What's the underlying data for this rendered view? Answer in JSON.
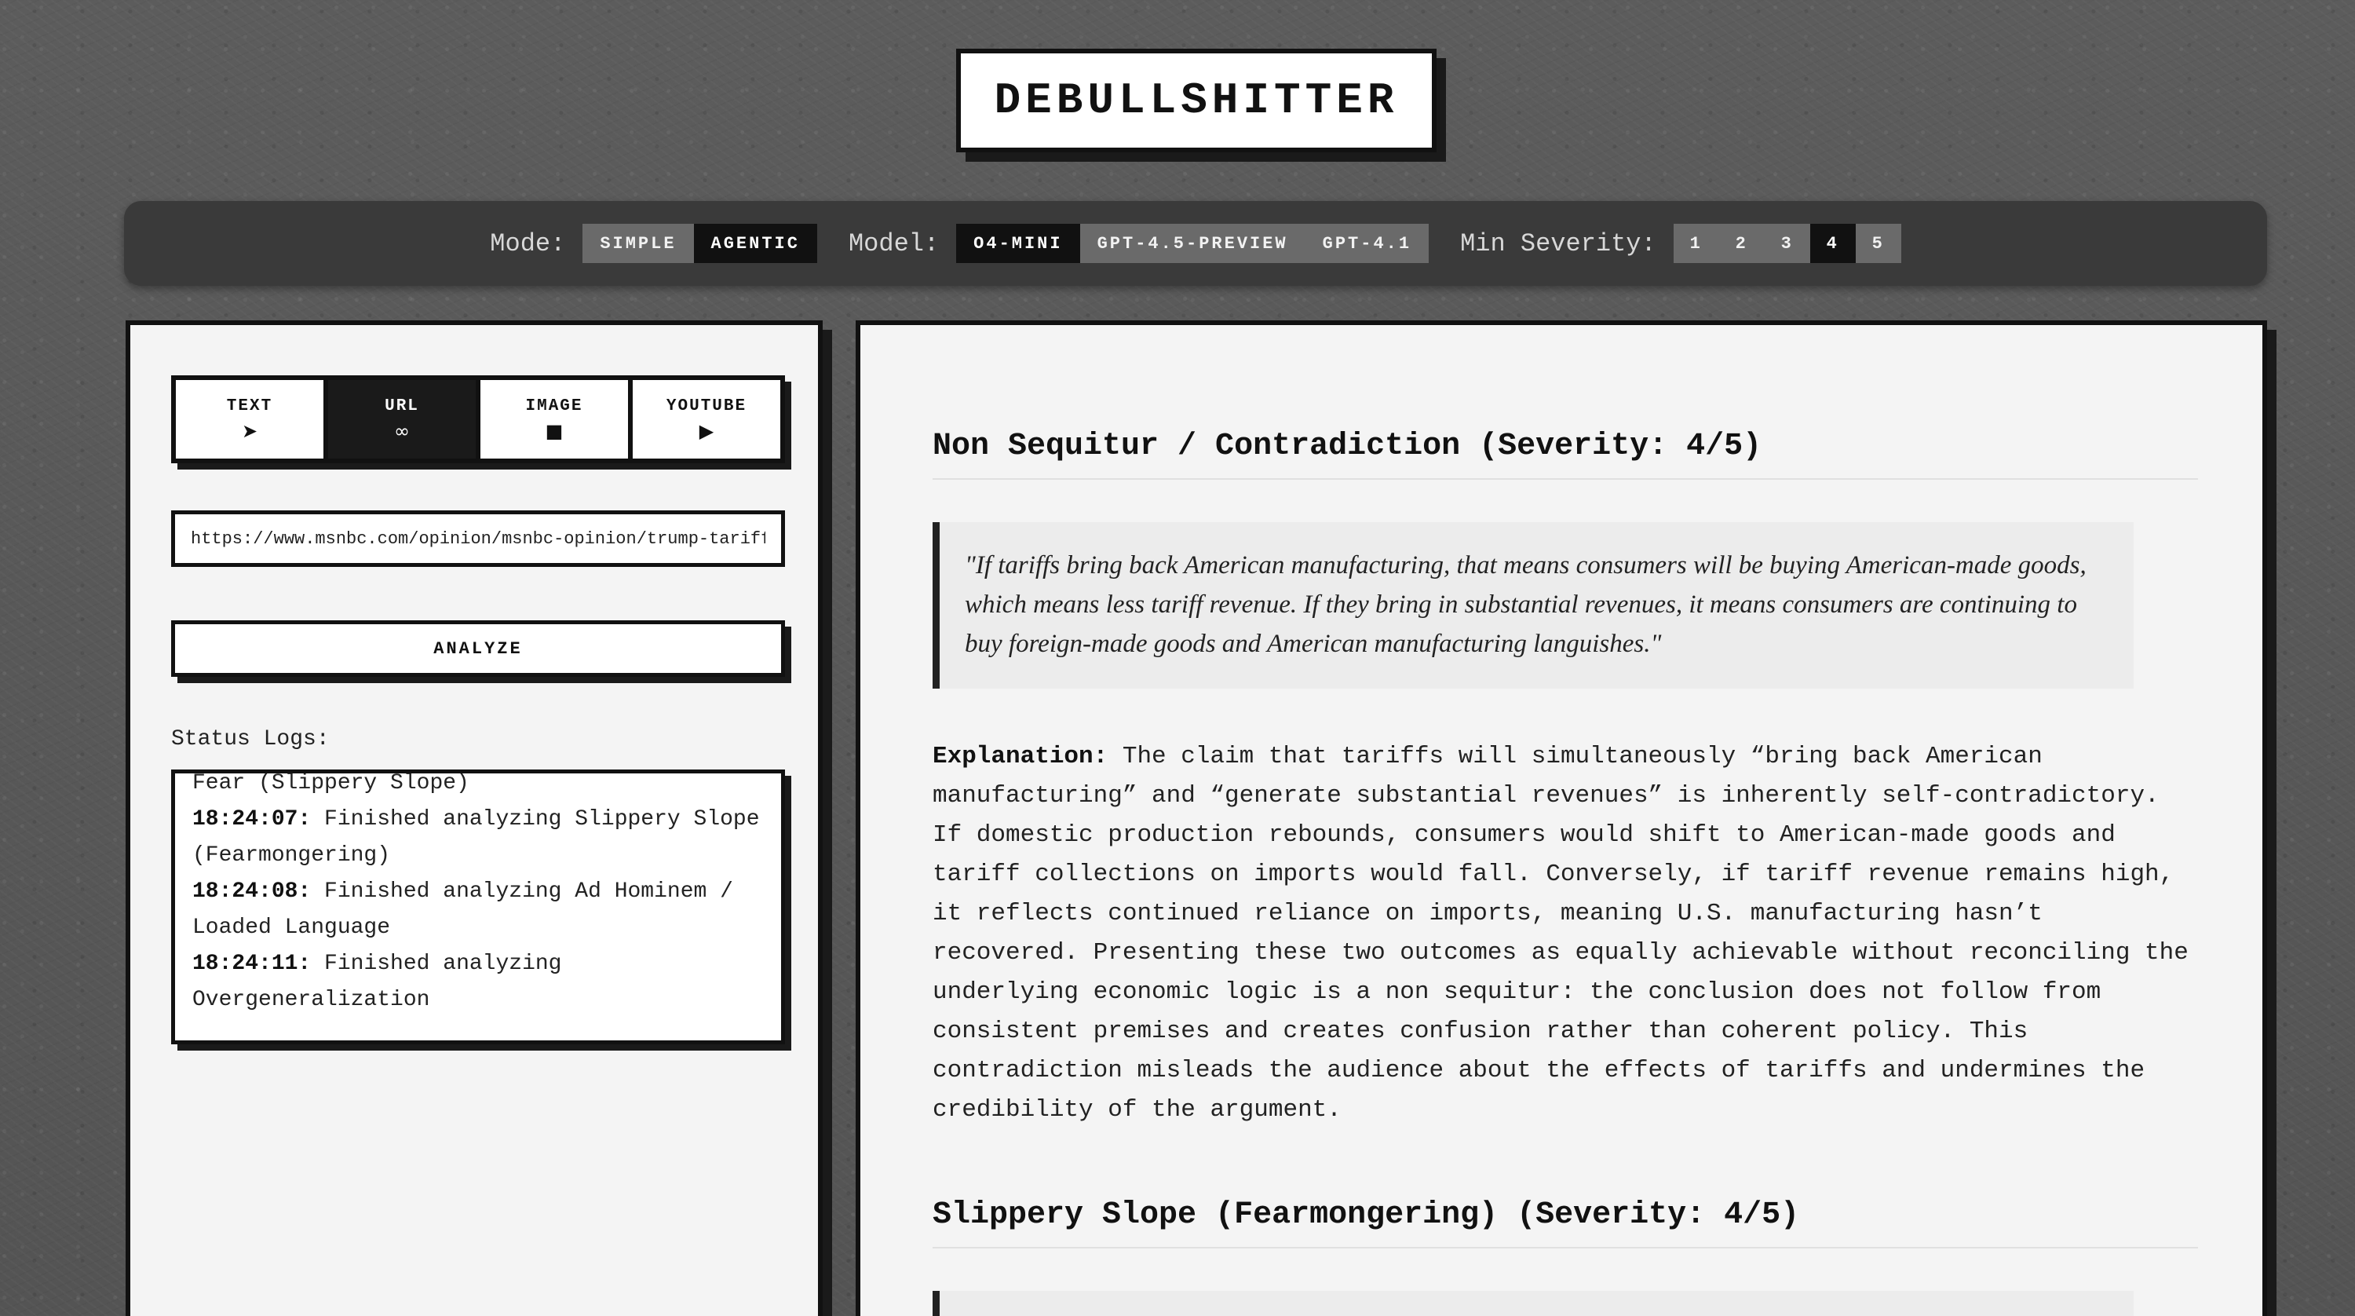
{
  "app": {
    "title": "DEBULLSHITTER"
  },
  "controls": {
    "mode_label": "Mode:",
    "mode_options": [
      "SIMPLE",
      "AGENTIC"
    ],
    "mode_selected": "AGENTIC",
    "model_label": "Model:",
    "model_options": [
      "O4-MINI",
      "GPT-4.5-PREVIEW",
      "GPT-4.1"
    ],
    "model_selected": "O4-MINI",
    "severity_label": "Min Severity:",
    "severity_options": [
      "1",
      "2",
      "3",
      "4",
      "5"
    ],
    "severity_selected": "4"
  },
  "input": {
    "tabs": [
      {
        "label": "TEXT",
        "icon": "➤",
        "icon_name": "arrow-icon"
      },
      {
        "label": "URL",
        "icon": "∞",
        "icon_name": "link-icon"
      },
      {
        "label": "IMAGE",
        "icon": "■",
        "icon_name": "image-icon"
      },
      {
        "label": "YOUTUBE",
        "icon": "▶",
        "icon_name": "play-icon"
      }
    ],
    "active_tab": "URL",
    "url_value": "https://www.msnbc.com/opinion/msnbc-opinion/trump-tariffs",
    "analyze_label": "ANALYZE"
  },
  "logs": {
    "title": "Status Logs:",
    "entries": [
      {
        "time": "",
        "text": "Fear (Slippery Slope)"
      },
      {
        "time": "18:24:07:",
        "text": " Finished analyzing Slippery Slope (Fearmongering)"
      },
      {
        "time": "18:24:08:",
        "text": " Finished analyzing Ad Hominem / Loaded Language"
      },
      {
        "time": "18:24:11:",
        "text": " Finished analyzing Overgeneralization"
      }
    ]
  },
  "results": [
    {
      "title": "Non Sequitur / Contradiction (Severity: 4/5)",
      "quote": "\"If tariffs bring back American manufacturing, that means consumers will be buying American-made goods, which means less tariff revenue. If they bring in substantial revenues, it means consumers are continuing to buy foreign-made goods and American manufacturing languishes.\"",
      "explanation_label": "Explanation:",
      "explanation": " The claim that tariffs will simultaneously “bring back American manufacturing” and “generate substantial revenues” is inherently self-contradictory. If domestic production rebounds, consumers would shift to American-made goods and tariff collections on imports would fall. Conversely, if tariff revenue remains high, it reflects continued reliance on imports, meaning U.S. manufacturing hasn’t recovered. Presenting these two outcomes as equally achievable without reconciling the underlying economic logic is a non sequitur: the conclusion does not follow from consistent premises and creates confusion rather than coherent policy. This contradiction misleads the audience about the effects of tariffs and undermines the credibility of the argument."
    },
    {
      "title": "Slippery Slope (Fearmongering) (Severity: 4/5)"
    }
  ]
}
